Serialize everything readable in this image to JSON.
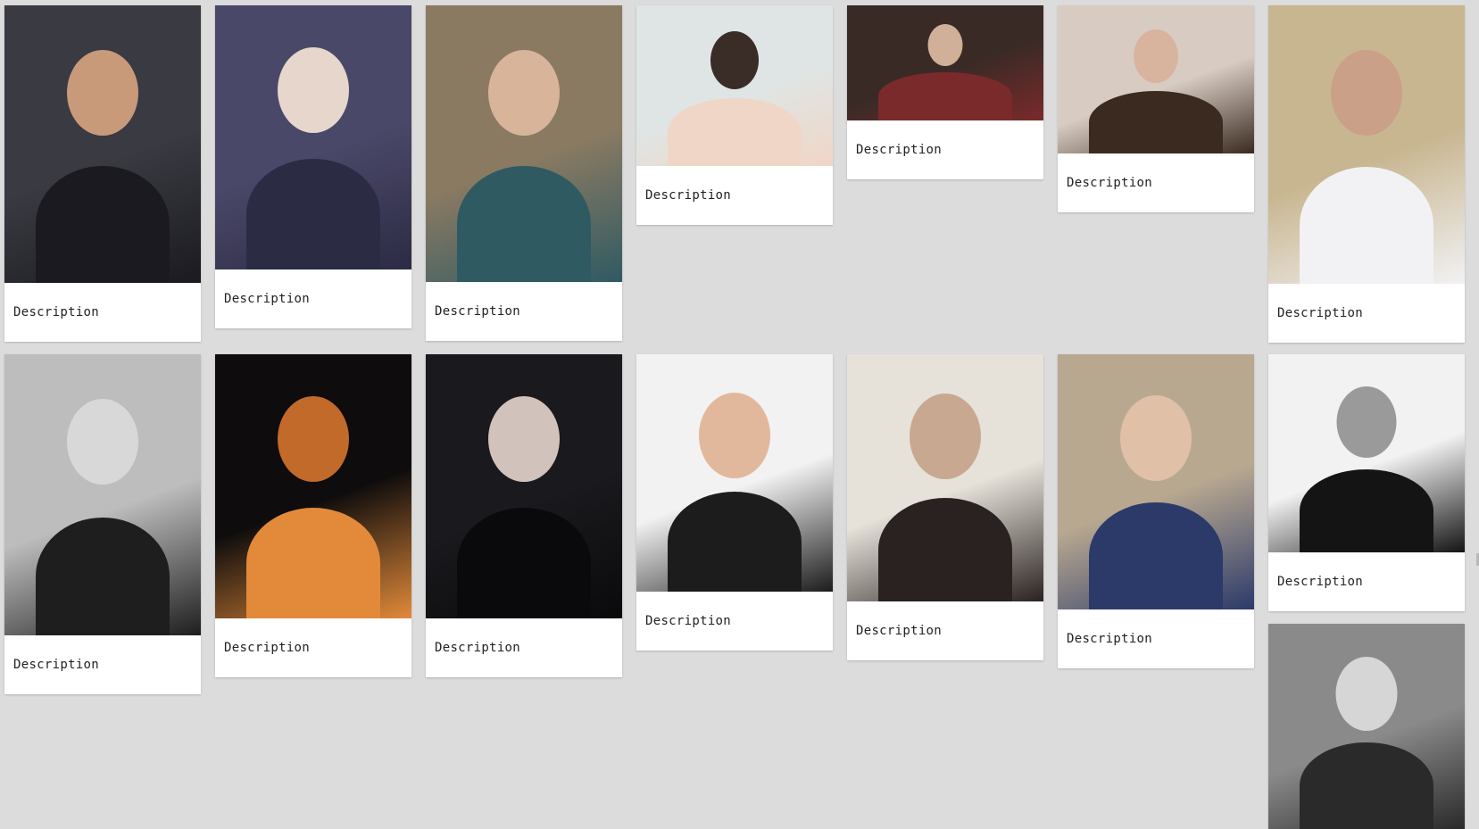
{
  "gallery": {
    "items": [
      {
        "caption": "Description",
        "image": "photo-man-glasses-suit-pointing",
        "tone": [
          "#3a3a42",
          "#1a1a20",
          "#c89a7a"
        ]
      },
      {
        "caption": "Description",
        "image": "photo-woman-paisley-dress",
        "tone": [
          "#4a4868",
          "#2c2b44",
          "#e6d6cc"
        ]
      },
      {
        "caption": "Description",
        "image": "photo-man-teal-coat-gq",
        "tone": [
          "#8a7a62",
          "#2f5a62",
          "#d8b49a"
        ]
      },
      {
        "caption": "Description",
        "image": "photo-woman-short-hair-portrait",
        "tone": [
          "#dfe5e4",
          "#f0d6c6",
          "#3a2c26"
        ]
      },
      {
        "caption": "Description",
        "image": "photo-man-red-jacket-car",
        "tone": [
          "#3a2a26",
          "#7a2a2a",
          "#d0b098"
        ]
      },
      {
        "caption": "Description",
        "image": "photo-woman-floral-top",
        "tone": [
          "#d8ccc2",
          "#3a2a20",
          "#d8b49e"
        ]
      },
      {
        "caption": "Description",
        "image": "photo-man-white-shirt-reaching",
        "tone": [
          "#c8b690",
          "#f2f2f4",
          "#caa088"
        ]
      },
      {
        "caption": "Description",
        "image": "photo-woman-curly-hair-bw",
        "tone": [
          "#bdbdbd",
          "#1e1e1e",
          "#d8d8d8"
        ]
      },
      {
        "caption": "Description",
        "image": "photo-man-dark-portrait",
        "tone": [
          "#0e0c0c",
          "#e28a3a",
          "#c26a2a"
        ]
      },
      {
        "caption": "Description",
        "image": "photo-woman-top-hat-mustache",
        "tone": [
          "#1a1a1e",
          "#0a0a0c",
          "#d2c2bc"
        ]
      },
      {
        "caption": "Description",
        "image": "photo-woman-clapperboard",
        "tone": [
          "#f2f2f2",
          "#1c1c1c",
          "#e2b89c"
        ]
      },
      {
        "caption": "Description",
        "image": "photo-man-leather-jacket",
        "tone": [
          "#e6e2da",
          "#2a2220",
          "#c8a890"
        ]
      },
      {
        "caption": "Description",
        "image": "photo-woman-blue-hat-street",
        "tone": [
          "#b8a890",
          "#2c3a6a",
          "#e0c0a6"
        ]
      },
      {
        "caption": "Description",
        "image": "photo-man-bw-closeup",
        "tone": [
          "#f2f2f2",
          "#141414",
          "#9a9a9a"
        ]
      },
      {
        "caption": "",
        "image": "photo-woman-bw-street",
        "tone": [
          "#8a8a8a",
          "#2a2a2a",
          "#d6d6d6"
        ]
      }
    ]
  }
}
